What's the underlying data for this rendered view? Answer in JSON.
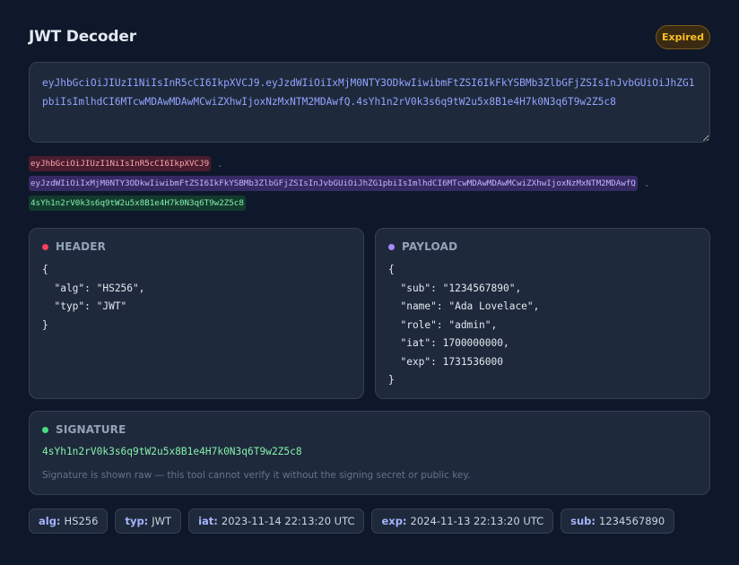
{
  "app": {
    "title": "JWT Decoder",
    "status_badge": "Expired"
  },
  "token": {
    "raw": "eyJhbGciOiJIUzI1NiIsInR5cCI6IkpXVCJ9.eyJzdWIiOiIxMjM0NTY3ODkwIiwibmFtZSI6IkFkYSBMb3ZlbGFjZSIsInJvbGUiOiJhZG1pbiIsImlhdCI6MTcwMDAwMDAwMCwiZXhwIjoxNzMxNTM2MDAwfQ.4sYh1n2rV0k3s6q9tW2u5x8B1e4H7k0N3q6T9w2Z5c8",
    "header_segment": "eyJhbGciOiJIUzI1NiIsInR5cCI6IkpXVCJ9",
    "payload_segment": "eyJzdWIiOiIxMjM0NTY3ODkwIiwibmFtZSI6IkFkYSBMb3ZlbGFjZSIsInJvbGUiOiJhZG1pbiIsImlhdCI6MTcwMDAwMDAwMCwiZXhwIjoxNzMxNTM2MDAwfQ",
    "signature_segment": "4sYh1n2rV0k3s6q9tW2u5x8B1e4H7k0N3q6T9w2Z5c8",
    "separator": "."
  },
  "header_panel": {
    "label": "HEADER",
    "json": "{\n  \"alg\": \"HS256\",\n  \"typ\": \"JWT\"\n}"
  },
  "payload_panel": {
    "label": "PAYLOAD",
    "json": "{\n  \"sub\": \"1234567890\",\n  \"name\": \"Ada Lovelace\",\n  \"role\": \"admin\",\n  \"iat\": 1700000000,\n  \"exp\": 1731536000\n}"
  },
  "signature_panel": {
    "label": "SIGNATURE",
    "value": "4sYh1n2rV0k3s6q9tW2u5x8B1e4H7k0N3q6T9w2Z5c8",
    "note": "Signature is shown raw — this tool cannot verify it without the signing secret or public key."
  },
  "claims": [
    {
      "key": "alg:",
      "value": "HS256"
    },
    {
      "key": "typ:",
      "value": "JWT"
    },
    {
      "key": "iat:",
      "value": "2023-11-14 22:13:20 UTC"
    },
    {
      "key": "exp:",
      "value": "2024-11-13 22:13:20 UTC"
    },
    {
      "key": "sub:",
      "value": "1234567890"
    }
  ],
  "colors": {
    "background": "#0f172a",
    "header_accent": "#f43f5e",
    "payload_accent": "#a78bfa",
    "signature_accent": "#4ade80",
    "expired_badge": "#fbbf24"
  }
}
